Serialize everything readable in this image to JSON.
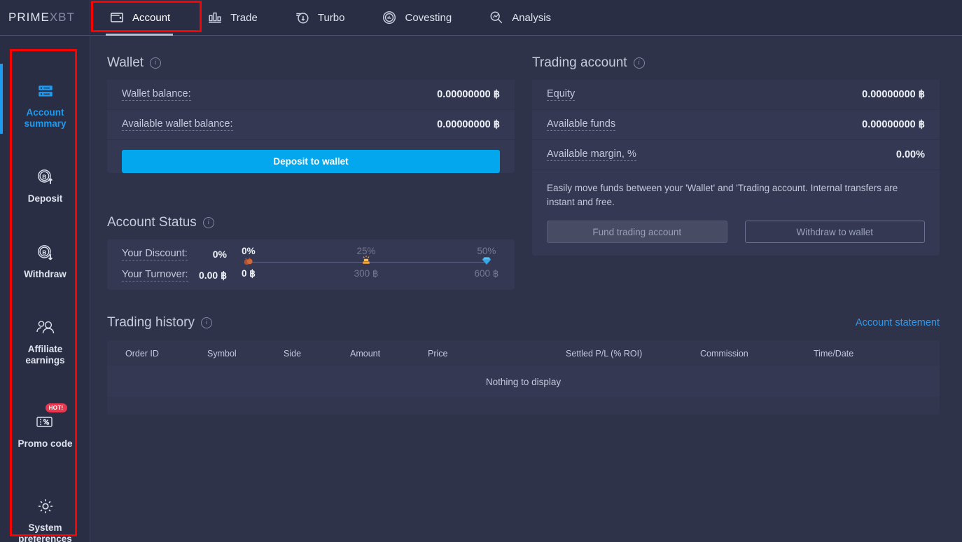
{
  "brand": {
    "prime": "PRIME",
    "xbt": "XBT"
  },
  "nav": {
    "tabs": [
      {
        "label": "Account",
        "icon": "wallet-icon",
        "active": true
      },
      {
        "label": "Trade",
        "icon": "bar-chart-icon",
        "active": false
      },
      {
        "label": "Turbo",
        "icon": "turbo-icon",
        "active": false
      },
      {
        "label": "Covesting",
        "icon": "covesting-icon",
        "active": false
      },
      {
        "label": "Analysis",
        "icon": "analysis-icon",
        "active": false
      }
    ]
  },
  "sidebar": {
    "items": [
      {
        "label": "Account summary",
        "icon": "server-icon",
        "active": true,
        "badge": ""
      },
      {
        "label": "Deposit",
        "icon": "bitcoin-up-icon",
        "active": false,
        "badge": ""
      },
      {
        "label": "Withdraw",
        "icon": "bitcoin-down-icon",
        "active": false,
        "badge": ""
      },
      {
        "label": "Affiliate earnings",
        "icon": "people-icon",
        "active": false,
        "badge": ""
      },
      {
        "label": "Promo code",
        "icon": "percent-ticket-icon",
        "active": false,
        "badge": "HOT!"
      },
      {
        "label": "System preferences",
        "icon": "gear-icon",
        "active": false,
        "badge": ""
      }
    ]
  },
  "wallet": {
    "title": "Wallet",
    "rows": [
      {
        "label": "Wallet balance:",
        "value": "0.00000000 ฿"
      },
      {
        "label": "Available wallet balance:",
        "value": "0.00000000 ฿"
      }
    ],
    "deposit_button": "Deposit to wallet"
  },
  "trading_account": {
    "title": "Trading account",
    "rows": [
      {
        "label": "Equity",
        "value": "0.00000000 ฿"
      },
      {
        "label": "Available funds",
        "value": "0.00000000 ฿"
      },
      {
        "label": "Available margin, %",
        "value": "0.00%"
      }
    ],
    "note": "Easily move funds between your 'Wallet' and 'Trading account. Internal transfers are instant and free.",
    "fund_button": "Fund trading account",
    "withdraw_button": "Withdraw to wallet"
  },
  "account_status": {
    "title": "Account Status",
    "discount_label": "Your Discount:",
    "discount_value": "0%",
    "turnover_label": "Your Turnover:",
    "turnover_value": "0.00 ฿",
    "tiers": [
      {
        "percent": "0%",
        "amount": "0 ฿",
        "icon": "bronze-medal-icon",
        "reached": true
      },
      {
        "percent": "25%",
        "amount": "300 ฿",
        "icon": "gold-bars-icon",
        "reached": false
      },
      {
        "percent": "50%",
        "amount": "600 ฿",
        "icon": "diamond-icon",
        "reached": false
      }
    ]
  },
  "trading_history": {
    "title": "Trading history",
    "statement_link": "Account statement",
    "columns": [
      "Order ID",
      "Symbol",
      "Side",
      "Amount",
      "Price",
      "Settled P/L (% ROI)",
      "Commission",
      "Time/Date"
    ],
    "empty_text": "Nothing to display",
    "rows": []
  },
  "colors": {
    "accent_blue": "#02a7ed",
    "active_blue": "#1e9bf0",
    "link_blue": "#2e9bf0",
    "panel_bg": "#343852",
    "page_bg": "#2f3349",
    "header_bg": "#2a2e44",
    "highlight_red": "#fe0000",
    "badge_red": "#e8384f"
  }
}
